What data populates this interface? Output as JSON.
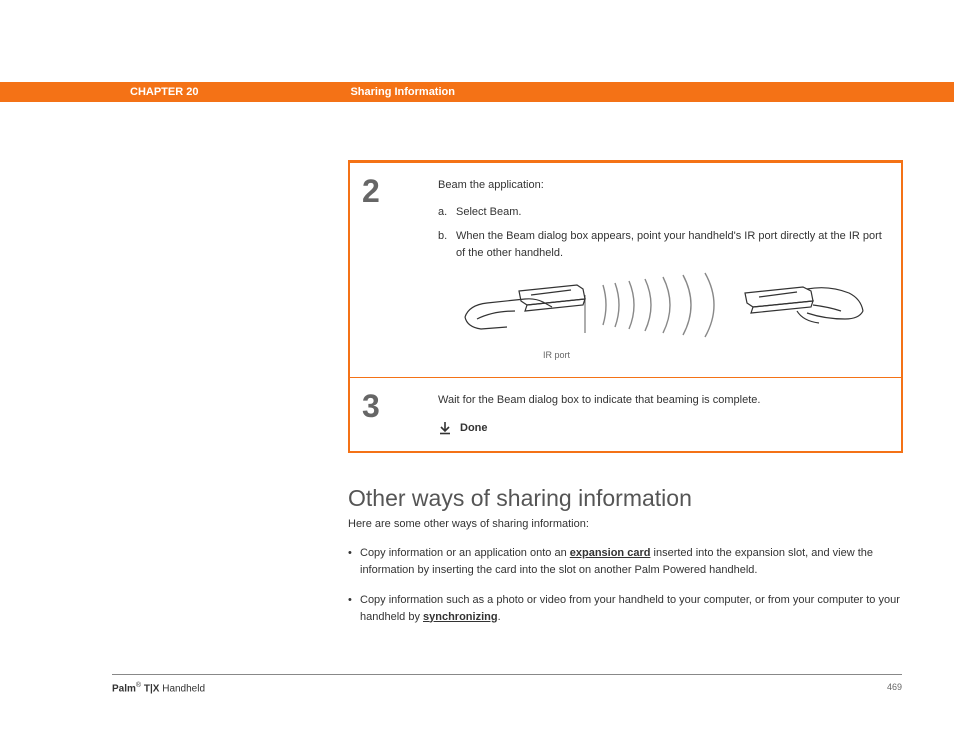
{
  "header": {
    "chapter": "CHAPTER 20",
    "section": "Sharing Information"
  },
  "steps": [
    {
      "number": "2",
      "intro": "Beam the application:",
      "sub_a_letter": "a.",
      "sub_a_text": "Select Beam.",
      "sub_b_letter": "b.",
      "sub_b_text": "When the Beam dialog box appears, point your handheld's IR port directly at the IR port of the other handheld.",
      "ir_port_label": "IR port"
    },
    {
      "number": "3",
      "intro": "Wait for the Beam dialog box to indicate that beaming is complete.",
      "done": "Done"
    }
  ],
  "heading": "Other ways of sharing information",
  "intro_text": "Here are some other ways of sharing information:",
  "bullets": [
    {
      "pre": "Copy information or an application onto an ",
      "link": "expansion card",
      "post": " inserted into the expansion slot, and view the information by inserting the card into the slot on another Palm Powered handheld."
    },
    {
      "pre": "Copy information such as a photo or video from your handheld to your computer, or from your computer to your handheld by ",
      "link": "synchronizing",
      "post": "."
    }
  ],
  "footer": {
    "brand_bold": "Palm",
    "brand_reg": "®",
    "brand_model": " T|X",
    "brand_suffix": " Handheld",
    "page": "469"
  }
}
